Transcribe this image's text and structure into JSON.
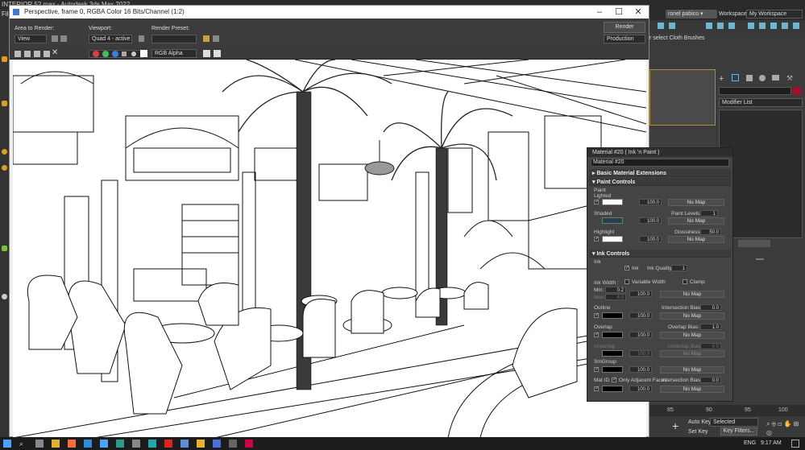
{
  "max": {
    "title": "INTERIOR 52.max - Autodesk 3ds Max 2022",
    "menu_first": "File",
    "user": "ronel pabico",
    "workspaces_label": "Workspaces:",
    "workspace": "My Workspace",
    "cloth_label": "r select Cloth Brushes",
    "modifier_list": "Modifier List",
    "timeline_ticks": [
      "85",
      "90",
      "95",
      "100"
    ],
    "auto_key": "Auto Key",
    "set_key": "Set Key",
    "selected": "Selected",
    "key_filters": "Key Filters..."
  },
  "render_window": {
    "title": "Perspective, frame 0, RGBA Color 16 Bits/Channel (1:2)",
    "area_to_render_label": "Area to Render:",
    "area_to_render_value": "View",
    "viewport_label": "Viewport:",
    "viewport_value": "Quad 4 - active",
    "render_preset_label": "Render Preset:",
    "render_preset_value": "",
    "render_button": "Render",
    "production_value": "Production",
    "channel_value": "RGB Alpha",
    "swatch_colors": [
      "#e23b3b",
      "#3fbf5a",
      "#3b7fe2"
    ]
  },
  "material_editor": {
    "title": "Material #20  ( Ink 'n Paint )",
    "material_name": "Material #20",
    "basic_extensions": "Basic Material Extensions",
    "paint_controls": "Paint Controls",
    "paint_label": "Paint",
    "lighted_label": "Lighted",
    "shaded_label": "Shaded",
    "highlight_label": "Highlight",
    "paint_levels_label": "Paint Levels:",
    "paint_levels": "1",
    "glossiness_label": "Glossiness:",
    "glossiness": "50.0",
    "lighted_value": "100.0",
    "shaded_value": "100.0",
    "highlight_value": "100.0",
    "no_map": "No Map",
    "ink_controls": "Ink Controls",
    "ink_label": "Ink",
    "ink_checkbox": "Ink",
    "ink_quality_label": "Ink Quality:",
    "ink_quality": "1",
    "ink_width_label": "Ink Width :",
    "variable_width": "Variable Width",
    "clamp": "Clamp",
    "min_label": "Min:",
    "min_value": "0.2",
    "max_label": "Max:",
    "max_value": "4.0",
    "width_value": "100.0",
    "outline_label": "Outline",
    "outline_value": "100.0",
    "intersection_bias_label": "Intersection Bias:",
    "intersection_bias": "0.0",
    "overlap_label": "Overlap",
    "overlap_value": "100.0",
    "overlap_bias_label": "Overlap Bias:",
    "overlap_bias": "1.0",
    "underlap_label": "Underlap",
    "underlap_value": "100.0",
    "underlap_bias_label": "Underlap Bias:",
    "underlap_bias": "0.0",
    "smgroup_label": "SmGroup",
    "smgroup_value": "100.0",
    "matid_label": "Mat ID",
    "only_adjacent": "Only Adjacent Faces",
    "matid_bias_label": "Intersection Bias:",
    "matid_bias": "0.0",
    "matid_value": "100.0",
    "lighted_color": "#ffffff",
    "shaded_color": "#24404f",
    "highlight_color": "#ffffff",
    "ink_color": "#000000"
  },
  "taskbar": {
    "language": "ENG",
    "time": "9:17 AM"
  }
}
